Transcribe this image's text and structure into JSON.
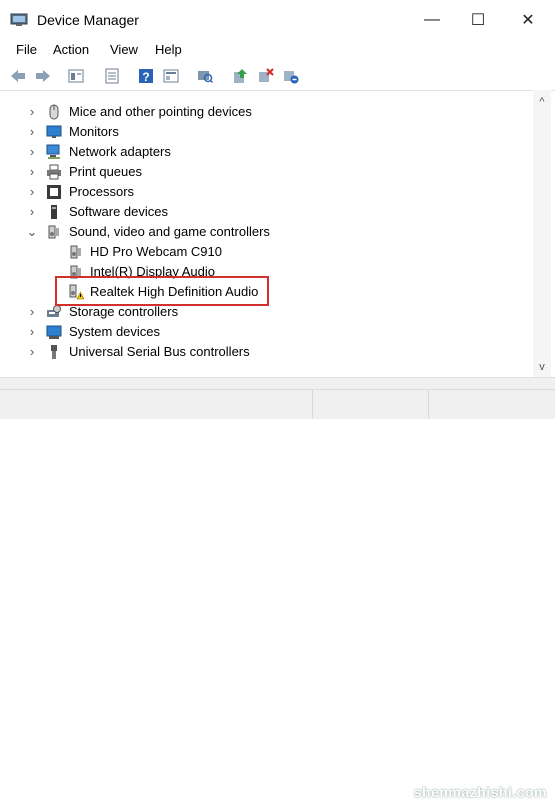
{
  "window": {
    "title": "Device Manager",
    "minimize_glyph": "—",
    "maximize_glyph": "☐",
    "close_glyph": "✕"
  },
  "menu": [
    "File",
    "Action",
    "View",
    "Help"
  ],
  "toolbar": [
    "back-icon",
    "forward-icon",
    "properties-icon",
    "list-icon",
    "help-icon",
    "view-icon",
    "scan-icon",
    "update-driver-icon",
    "uninstall-icon",
    "disable-icon"
  ],
  "tree": {
    "rows": [
      {
        "label": "Mice and other pointing devices",
        "icon": "mouse-icon",
        "expander": "›",
        "indent": 0
      },
      {
        "label": "Monitors",
        "icon": "monitor-icon",
        "expander": "›",
        "indent": 0
      },
      {
        "label": "Network adapters",
        "icon": "network-adapter-icon",
        "expander": "›",
        "indent": 0
      },
      {
        "label": "Print queues",
        "icon": "printer-icon",
        "expander": "›",
        "indent": 0
      },
      {
        "label": "Processors",
        "icon": "processor-icon",
        "expander": "›",
        "indent": 0
      },
      {
        "label": "Software devices",
        "icon": "software-device-icon",
        "expander": "›",
        "indent": 0
      },
      {
        "label": "Sound, video and game controllers",
        "icon": "speaker-icon",
        "expander": "⌄",
        "indent": 0
      },
      {
        "label": "HD Pro Webcam C910",
        "icon": "speaker-icon",
        "expander": "",
        "indent": 1
      },
      {
        "label": "Intel(R) Display Audio",
        "icon": "speaker-icon",
        "expander": "",
        "indent": 1
      },
      {
        "label": "Realtek High Definition Audio",
        "icon": "speaker-warning-icon",
        "expander": "",
        "indent": 1
      },
      {
        "label": "Storage controllers",
        "icon": "storage-icon",
        "expander": "›",
        "indent": 0
      },
      {
        "label": "System devices",
        "icon": "system-device-icon",
        "expander": "›",
        "indent": 0
      },
      {
        "label": "Universal Serial Bus controllers",
        "icon": "usb-icon",
        "expander": "›",
        "indent": 0
      }
    ]
  },
  "scrollbar": {
    "up": "^",
    "down": "v"
  },
  "watermark": "shenmazhishi.com",
  "colors": {
    "highlight_border": "#d0312d"
  }
}
